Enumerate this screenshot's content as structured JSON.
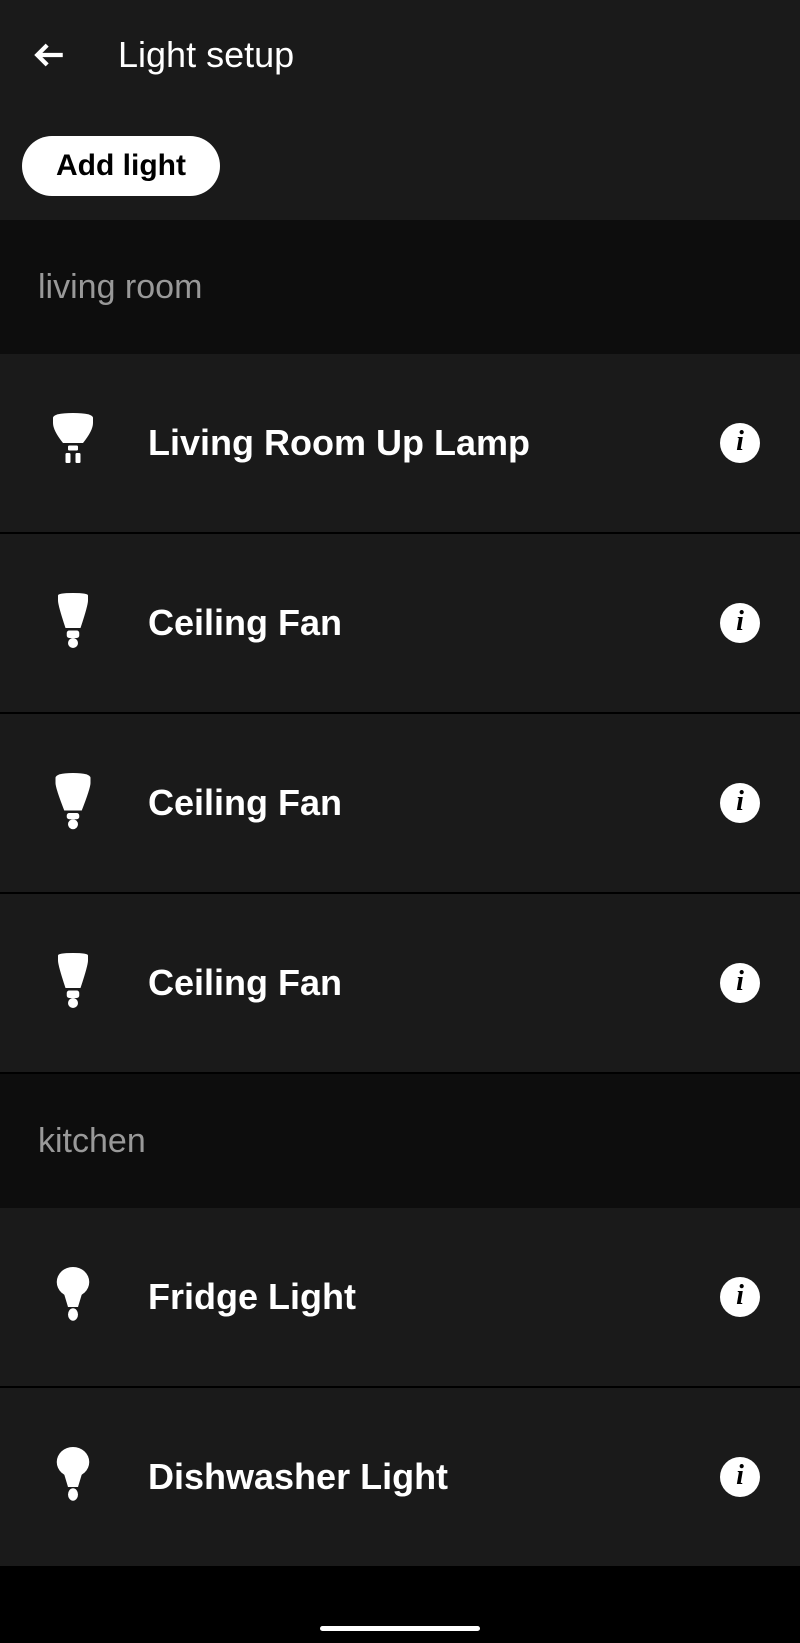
{
  "header": {
    "title": "Light setup"
  },
  "toolbar": {
    "add_label": "Add light"
  },
  "sections": [
    {
      "title": "living room",
      "lights": [
        {
          "name": "Living Room Up Lamp",
          "icon": "spotlight"
        },
        {
          "name": "Ceiling Fan",
          "icon": "bulb-tapered"
        },
        {
          "name": "Ceiling Fan",
          "icon": "bulb-tapered-wide"
        },
        {
          "name": "Ceiling Fan",
          "icon": "bulb-tapered"
        }
      ]
    },
    {
      "title": "kitchen",
      "lights": [
        {
          "name": "Fridge Light",
          "icon": "bulb-round"
        },
        {
          "name": "Dishwasher Light",
          "icon": "bulb-round"
        }
      ]
    }
  ]
}
